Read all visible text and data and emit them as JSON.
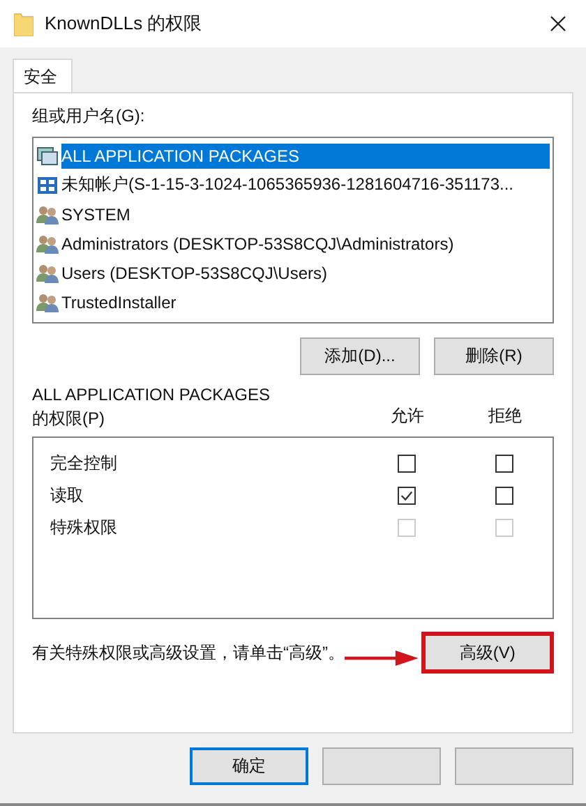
{
  "window": {
    "title": "KnownDLLs 的权限"
  },
  "tabs": [
    {
      "label": "安全",
      "selected": true
    }
  ],
  "principals": {
    "label": "组或用户名(G):",
    "items": [
      {
        "name": "ALL APPLICATION PACKAGES",
        "kind": "package",
        "selected": true
      },
      {
        "name": "未知帐户(S-1-15-3-1024-1065365936-1281604716-351173...",
        "kind": "unknown",
        "selected": false
      },
      {
        "name": "SYSTEM",
        "kind": "group",
        "selected": false
      },
      {
        "name": "Administrators (DESKTOP-53S8CQJ\\Administrators)",
        "kind": "group",
        "selected": false
      },
      {
        "name": "Users (DESKTOP-53S8CQJ\\Users)",
        "kind": "group",
        "selected": false
      },
      {
        "name": "TrustedInstaller",
        "kind": "group",
        "selected": false
      }
    ]
  },
  "principal_buttons": [
    "添加(D)...",
    "删除(R)"
  ],
  "permissions": {
    "label_line_1": "ALL APPLICATION PACKAGES",
    "label_line_2": "的权限(P)",
    "allow_heading": "允许",
    "deny_heading": "拒绝",
    "rows": [
      {
        "name": "完全控制",
        "allow": {
          "checked": false,
          "disabled": false
        },
        "deny": {
          "checked": false,
          "disabled": false
        }
      },
      {
        "name": "读取",
        "allow": {
          "checked": true,
          "disabled": false
        },
        "deny": {
          "checked": false,
          "disabled": false
        }
      },
      {
        "name": "特殊权限",
        "allow": {
          "checked": false,
          "disabled": true
        },
        "deny": {
          "checked": false,
          "disabled": true
        }
      }
    ]
  },
  "advanced": {
    "note": "有关特殊权限或高级设置，请单击“高级”。",
    "button": "高级(V)",
    "highlighted": true
  },
  "dialog_buttons": [
    {
      "label": "确定",
      "default": true
    },
    {
      "default": false
    },
    {
      "default": false
    }
  ]
}
